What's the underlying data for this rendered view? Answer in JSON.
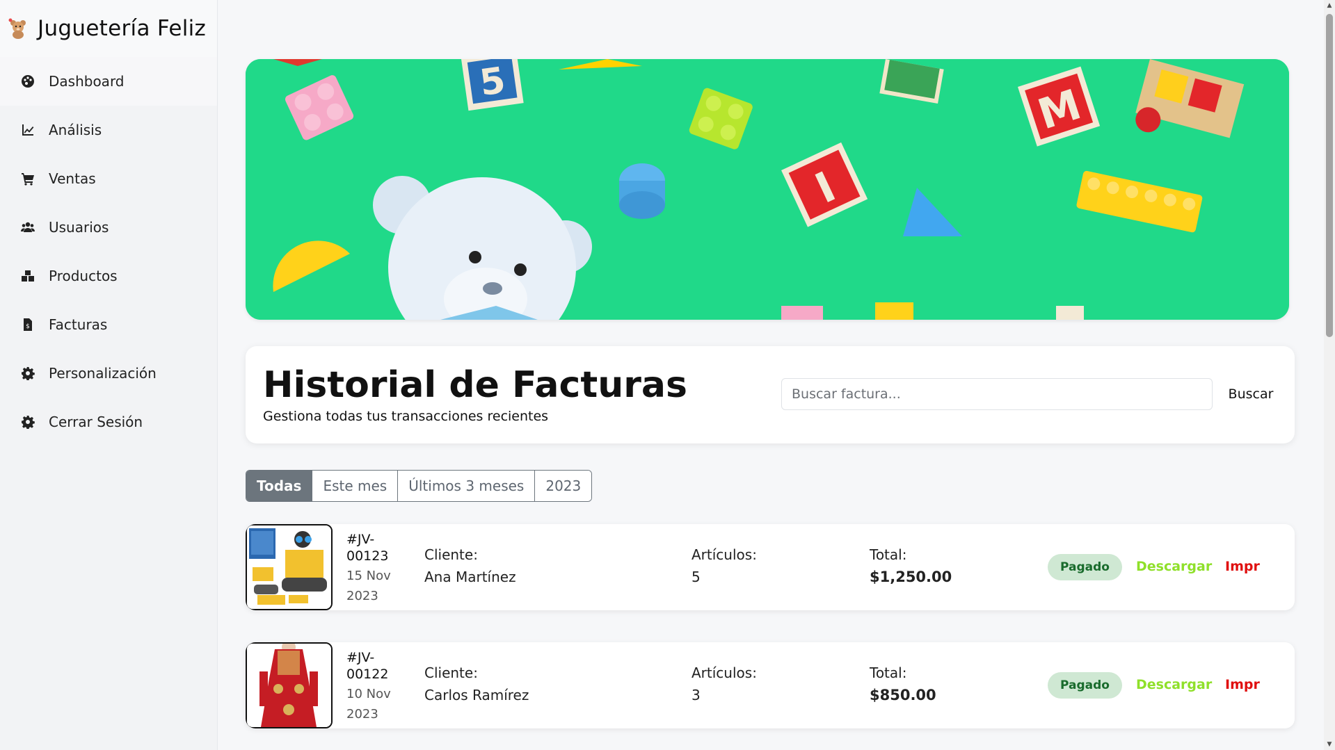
{
  "brand": {
    "name": "Juguetería Feliz",
    "logo_icon": "teddy-bear-logo"
  },
  "sidebar": {
    "items": [
      {
        "label": "Dashboard",
        "icon": "palette-icon"
      },
      {
        "label": "Análisis",
        "icon": "chart-line-icon"
      },
      {
        "label": "Ventas",
        "icon": "cart-icon"
      },
      {
        "label": "Usuarios",
        "icon": "users-icon"
      },
      {
        "label": "Productos",
        "icon": "boxes-icon"
      },
      {
        "label": "Facturas",
        "icon": "invoice-icon"
      },
      {
        "label": "Personalización",
        "icon": "gear-icon"
      },
      {
        "label": "Cerrar Sesión",
        "icon": "gear-icon"
      }
    ]
  },
  "header": {
    "title": "Historial de Facturas",
    "subtitle": "Gestiona todas tus transacciones recientes",
    "search_placeholder": "Buscar factura...",
    "search_button": "Buscar"
  },
  "filters": [
    {
      "label": "Todas",
      "active": true
    },
    {
      "label": "Este mes",
      "active": false
    },
    {
      "label": "Últimos 3 meses",
      "active": false
    },
    {
      "label": "2023",
      "active": false
    }
  ],
  "invoices": [
    {
      "id": "#JV-00123",
      "date": "15 Nov 2023",
      "client_label": "Cliente:",
      "client": "Ana Martínez",
      "items_label": "Artículos:",
      "items": "5",
      "total_label": "Total:",
      "total": "$1,250.00",
      "status": "Pagado",
      "download": "Descargar",
      "print": "Impr"
    },
    {
      "id": "#JV-00122",
      "date": "10 Nov 2023",
      "client_label": "Cliente:",
      "client": "Carlos Ramírez",
      "items_label": "Artículos:",
      "items": "3",
      "total_label": "Total:",
      "total": "$850.00",
      "status": "Pagado",
      "download": "Descargar",
      "print": "Impr"
    }
  ],
  "colors": {
    "hero_green": "#22dc8a",
    "badge_bg": "#cfe8d3",
    "badge_text": "#196b2c",
    "download": "#8fe02a",
    "print": "#e01010",
    "filter_active": "#6c757d"
  }
}
